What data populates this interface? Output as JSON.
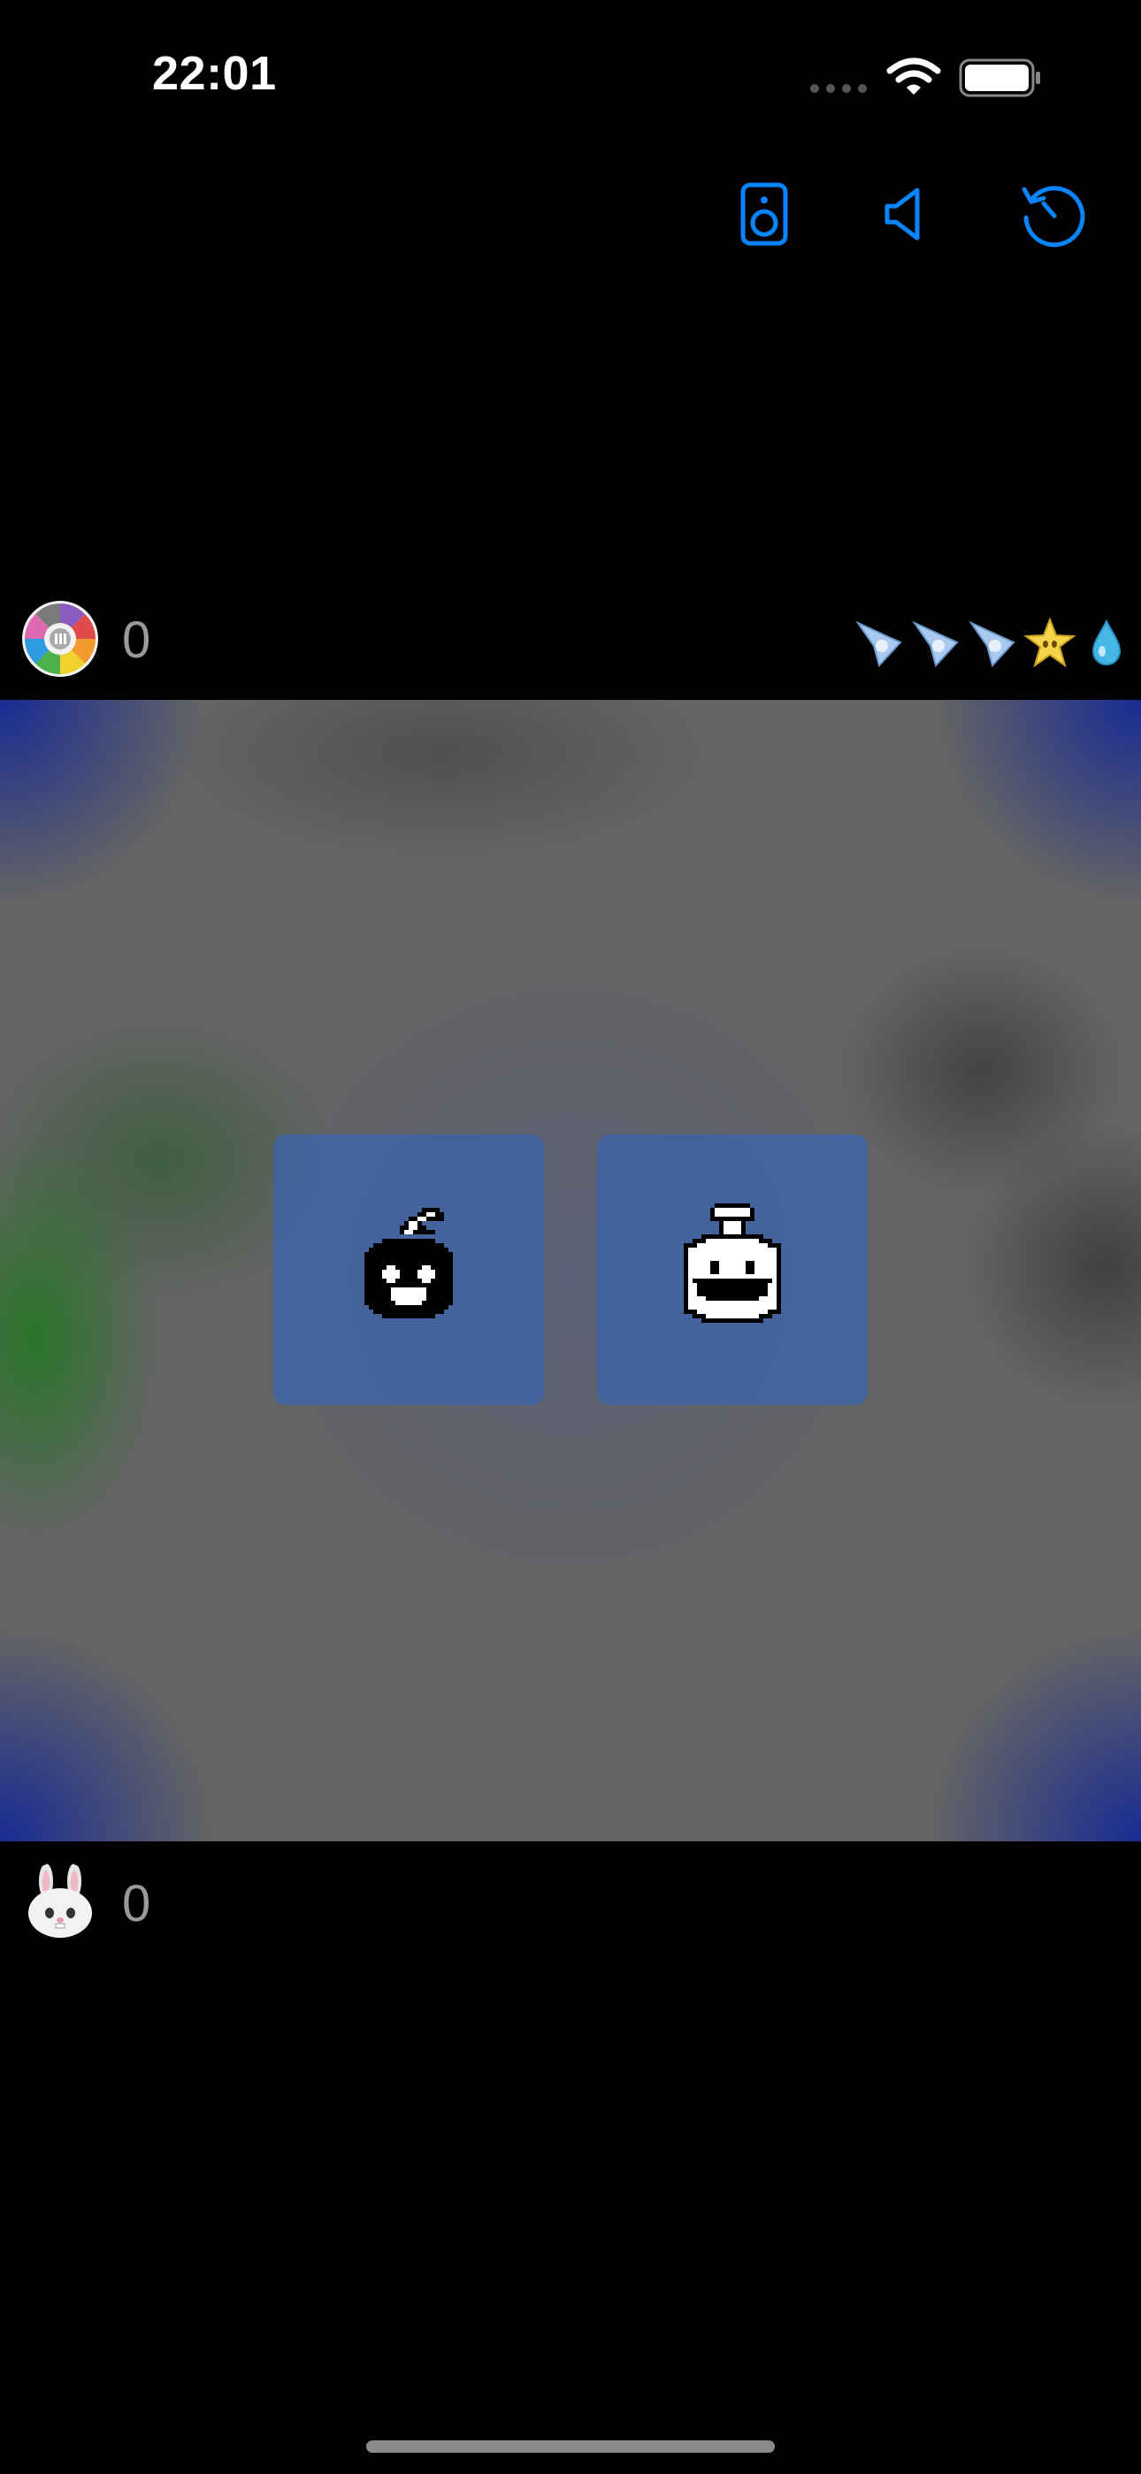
{
  "status_bar": {
    "time": "22:01",
    "icons": [
      "signal-dots-icon",
      "wifi-icon",
      "battery-icon"
    ]
  },
  "controls": [
    {
      "name": "speaker-button",
      "icon": "speaker-icon"
    },
    {
      "name": "volume-button",
      "icon": "volume-icon"
    },
    {
      "name": "restart-button",
      "icon": "restart-icon"
    }
  ],
  "opponent": {
    "avatar": "color-wheel-avatar",
    "score": "0",
    "inventory": [
      "paper-plane-icon",
      "paper-plane-icon",
      "paper-plane-icon",
      "star-icon",
      "droplet-icon"
    ]
  },
  "board": {
    "tiles": [
      {
        "name": "bomb",
        "icon": "bomb-icon"
      },
      {
        "name": "potion",
        "icon": "potion-icon"
      }
    ]
  },
  "player": {
    "avatar": "bunny-avatar",
    "score": "0"
  },
  "colors": {
    "accent": "#0a84ff",
    "background": "#000000",
    "board": "#646464",
    "tile": "#3c64aa",
    "score_text": "#9a9a9a"
  }
}
